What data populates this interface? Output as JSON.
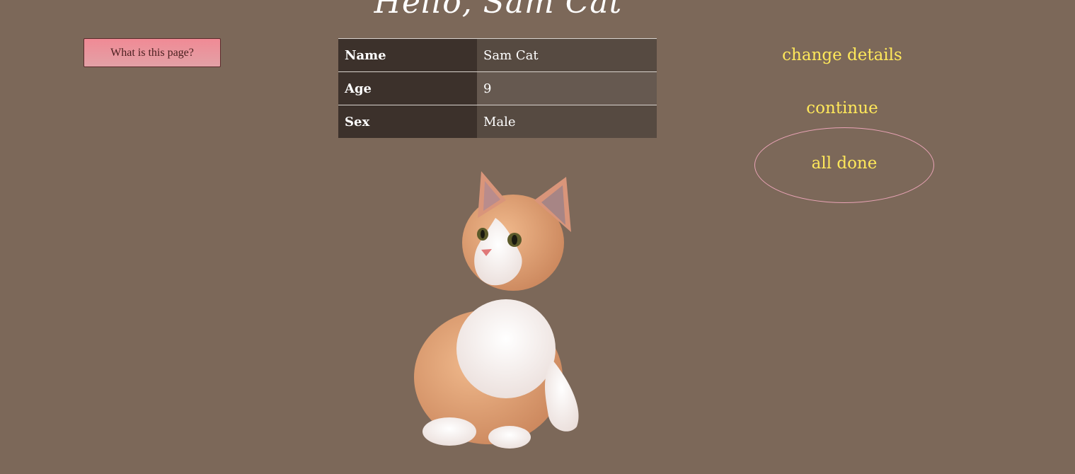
{
  "header": {
    "greeting": "Hello, Sam Cat"
  },
  "help": {
    "button_label": "What is this page?"
  },
  "profile_table": {
    "rows": [
      {
        "key": "Name",
        "value": "Sam Cat"
      },
      {
        "key": "Age",
        "value": "9"
      },
      {
        "key": "Sex",
        "value": "Male"
      }
    ]
  },
  "menu": {
    "change_details": "change details",
    "continue": "continue",
    "all_done": "all done"
  },
  "image": {
    "subject": "kitten-photo"
  },
  "colors": {
    "background": "#7c6859",
    "link": "#ffe85a",
    "button_fill": "#f08a95",
    "oval_border": "#e9a3b6"
  }
}
